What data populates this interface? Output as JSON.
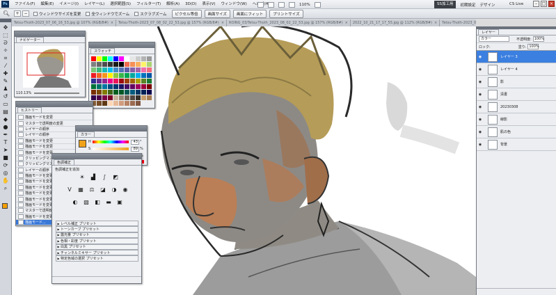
{
  "app": {
    "logo": "Ps"
  },
  "menu": [
    "ファイル(F)",
    "編集(E)",
    "イメージ(I)",
    "レイヤー(L)",
    "選択範囲(S)",
    "フィルター(T)",
    "解析(A)",
    "3D(D)",
    "表示(V)",
    "ウィンドウ(W)",
    "ヘルプ(H)"
  ],
  "menubar_zoom": "110%",
  "workspace": {
    "active": "SS加工用",
    "items": [
      "初期設定",
      "デザイン"
    ],
    "cs_live": "CS Live"
  },
  "options": {
    "checks": [
      "ウィンドウサイズを変更",
      "全ウィンドウでズーム",
      "スクラブズーム"
    ],
    "buttons": [
      "ピクセル等倍",
      "画面サイズ",
      "画面にフィット",
      "プリントサイズ"
    ]
  },
  "tabs": [
    {
      "label": "Tetsu-Thoth-2023_07_06_16_53.jpg @ 107% (RGB/8#)",
      "active": false
    },
    {
      "label": "Tetsu-Thoth-2023_07_08_02_22_53.jpg @ 157% (RGB/8#)",
      "active": false
    },
    {
      "label": "ROING_03/Tetsu-Thoth_2023_08_02_22_53.jpg @ 157% (RGB/8#)",
      "active": false
    },
    {
      "label": "2022_10_21_17_17_55.jpg @ 112% (RGB/8#)",
      "active": false
    },
    {
      "label": "Tetsu-Thoth-2023_07_29_21_16_18.jpg @ 50% (RGB/8#)",
      "active": false
    },
    {
      "label": "20230308_新アイコン.psd @ 110% (レイヤー 3, RGB/8#)",
      "active": true
    }
  ],
  "navigator": {
    "tab": "ナビゲーター",
    "zoom": "110.13%"
  },
  "swatches": {
    "tab": "スウォッチ",
    "colors": [
      "#ff0000",
      "#ffff00",
      "#00ff00",
      "#00ffff",
      "#0000ff",
      "#ff00ff",
      "#ffffff",
      "#e6e6e6",
      "#cccccc",
      "#b3b3b3",
      "#999999",
      "#808080",
      "#666666",
      "#4d4d4d",
      "#333333",
      "#1a1a1a",
      "#000000",
      "#f26c4f",
      "#f68e55",
      "#fbaf5c",
      "#fff467",
      "#acd372",
      "#7cc576",
      "#3bb878",
      "#1abbb4",
      "#00bff3",
      "#438cca",
      "#5574b9",
      "#605ca8",
      "#855fa8",
      "#a763a8",
      "#f06eaa",
      "#f26d7d",
      "#ed1c24",
      "#f26522",
      "#f7941d",
      "#fff200",
      "#8dc63f",
      "#39b54a",
      "#00a651",
      "#00a99d",
      "#00aeef",
      "#0072bc",
      "#0054a6",
      "#2e3192",
      "#662d91",
      "#92278f",
      "#ec008c",
      "#ed145b",
      "#9e0b0f",
      "#a0410d",
      "#a36209",
      "#aba000",
      "#598527",
      "#1a7b30",
      "#007236",
      "#00746b",
      "#0076a3",
      "#004b80",
      "#003471",
      "#1b1464",
      "#440e62",
      "#630460",
      "#9e005d",
      "#9e0039",
      "#790000",
      "#7b2e00",
      "#7d4900",
      "#827b00",
      "#406618",
      "#005e20",
      "#005826",
      "#005952",
      "#005b7f",
      "#003663",
      "#002157",
      "#0d004c",
      "#32004b",
      "#4b0049",
      "#7b0046",
      "#7a0026",
      "#c7b299",
      "#998675",
      "#736357",
      "#534741",
      "#37302a",
      "#c69c6d",
      "#a67c52",
      "#8c6239",
      "#754c24",
      "#603913",
      "#ffd7b5",
      "#e8b996",
      "#d19c7d",
      "#b78264",
      "#9b6a4f",
      "#7f5540"
    ]
  },
  "history": {
    "tab": "ヒストリー",
    "items": [
      "描画モードを変更",
      "マスターで透明度の変更",
      "レイヤーの順序",
      "レイヤーの順序",
      "描画モードを変更",
      "描画モードを変更",
      "描画モードを変更",
      "クリッピングマスク",
      "クリッピングマスク",
      "レイヤーの順序",
      "描画モードを変更",
      "描画モードを変更",
      "描画モードを変更",
      "描画モードを変更",
      "描画モードを変更",
      "描画モードを変更",
      "マスターで透明度",
      "描画モードを変更",
      "描画モード..."
    ],
    "selected_index": 18
  },
  "color": {
    "tab": "カラー",
    "channels": [
      {
        "label": "H",
        "value": "43"
      },
      {
        "label": "S",
        "value": "89"
      },
      {
        "label": "B",
        "value": "100"
      }
    ],
    "fg": "#f0a21a"
  },
  "adjustments": {
    "tab": "色調補正",
    "header": "色調補正を追加",
    "presets": [
      "レベル補正 プリセット",
      "トーンカーブ プリセット",
      "露光量 プリセット",
      "色相・彩度 プリセット",
      "白黒 プリセット",
      "チャンネルミキサー プリセット",
      "特定色域の選択 プリセット"
    ]
  },
  "layers": {
    "tab": "レイヤー",
    "blend": "カラー",
    "opacity_label": "不透明度:",
    "opacity": "100%",
    "lock_label": "ロック:",
    "fill_label": "塗り:",
    "fill": "100%",
    "items": [
      {
        "name": "レイヤー 3",
        "selected": true
      },
      {
        "name": "レイヤー 4",
        "selected": false
      },
      {
        "name": "影",
        "selected": false
      },
      {
        "name": "清書",
        "selected": false
      },
      {
        "name": "20230308",
        "selected": false
      },
      {
        "name": "線影",
        "selected": false
      },
      {
        "name": "肌の色",
        "selected": false
      },
      {
        "name": "背景",
        "selected": false
      }
    ]
  }
}
